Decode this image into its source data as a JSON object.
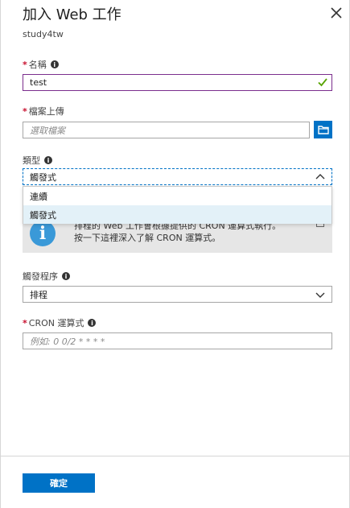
{
  "blade": {
    "title": "加入 Web 工作",
    "subtitle": "study4tw",
    "close_icon": "close-icon"
  },
  "fields": {
    "name": {
      "label": "名稱",
      "value": "test",
      "valid_icon": "checkmark-icon"
    },
    "file": {
      "label": "檔案上傳",
      "placeholder": "選取檔案",
      "browse_icon": "folder-icon"
    },
    "type": {
      "label": "類型",
      "selected": "觸發式",
      "options": [
        "連續",
        "觸發式"
      ]
    },
    "trigger": {
      "label": "觸發程序",
      "selected": "排程"
    },
    "cron": {
      "label": "CRON 運算式",
      "placeholder": "例如: 0 0/2 * * * *"
    }
  },
  "infobox": {
    "line1": "排程的 Web 工作會根據提供的 CRON 運算式執行。",
    "line2": "按一下這裡深入了解 CRON 運算式。"
  },
  "footer": {
    "ok_label": "確定"
  },
  "colors": {
    "accent": "#0072c6",
    "required": "#c8102e",
    "valid": "#57a300",
    "focus_border": "#7b2e8d"
  }
}
